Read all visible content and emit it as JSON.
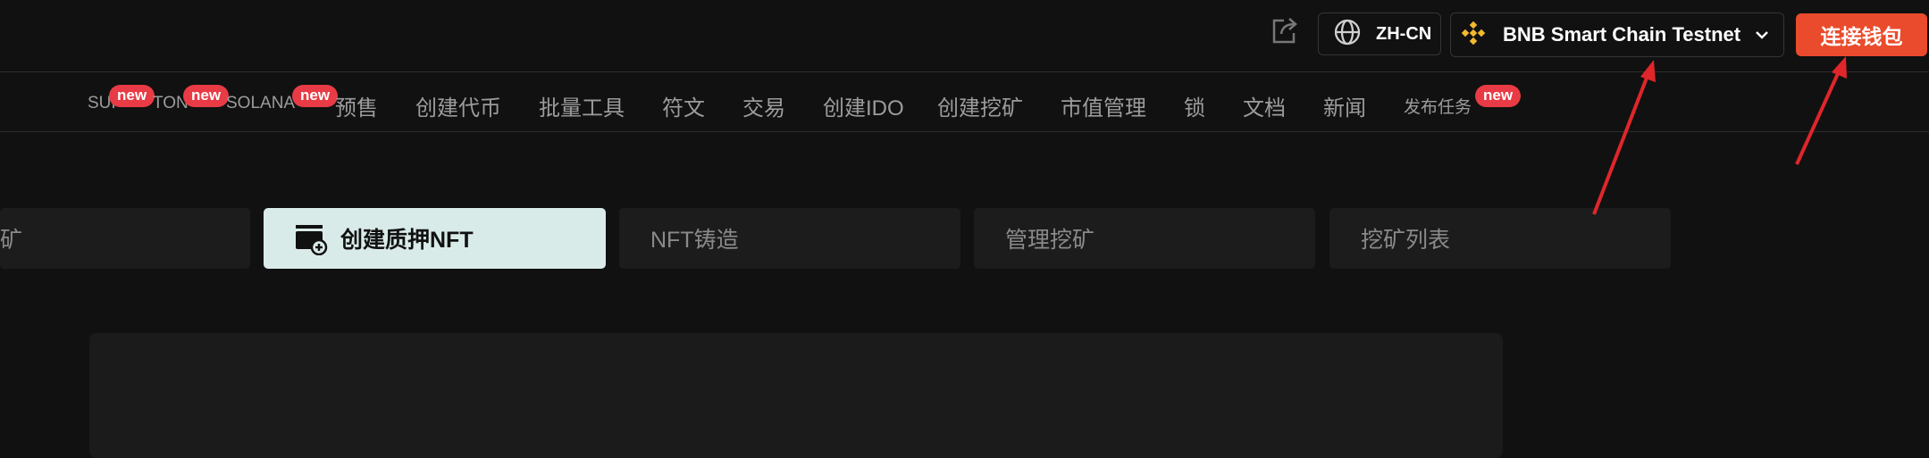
{
  "header": {
    "share_icon": "share-icon",
    "language": {
      "label": "ZH-CN",
      "icon": "globe-icon"
    },
    "chain": {
      "label": "BNB Smart Chain Testnet",
      "icon": "bnb-logo-icon",
      "dropdown_icon": "chevron-down-icon"
    },
    "connect_label": "连接钱包",
    "connect_color": "#ea4b2c"
  },
  "nav": {
    "badge_label": "new",
    "items": [
      {
        "label": "SUI",
        "badge": "new"
      },
      {
        "label": "TON",
        "badge": "new"
      },
      {
        "label": "SOLANA",
        "badge": "new"
      },
      {
        "label": "预售"
      },
      {
        "label": "创建代币"
      },
      {
        "label": "批量工具"
      },
      {
        "label": "符文"
      },
      {
        "label": "交易"
      },
      {
        "label": "创建IDO"
      },
      {
        "label": "创建挖矿"
      },
      {
        "label": "市值管理"
      },
      {
        "label": "锁"
      },
      {
        "label": "文档"
      },
      {
        "label": "新闻"
      },
      {
        "label": "发布任务",
        "badge": "new"
      }
    ]
  },
  "tabs": [
    {
      "label": "挖矿",
      "active": false
    },
    {
      "label": "创建质押NFT",
      "active": true,
      "icon": "create-staking-icon"
    },
    {
      "label": "NFT铸造",
      "active": false
    },
    {
      "label": "管理挖矿",
      "active": false
    },
    {
      "label": "挖矿列表",
      "active": false
    }
  ],
  "annotation_color": "#e0262b"
}
